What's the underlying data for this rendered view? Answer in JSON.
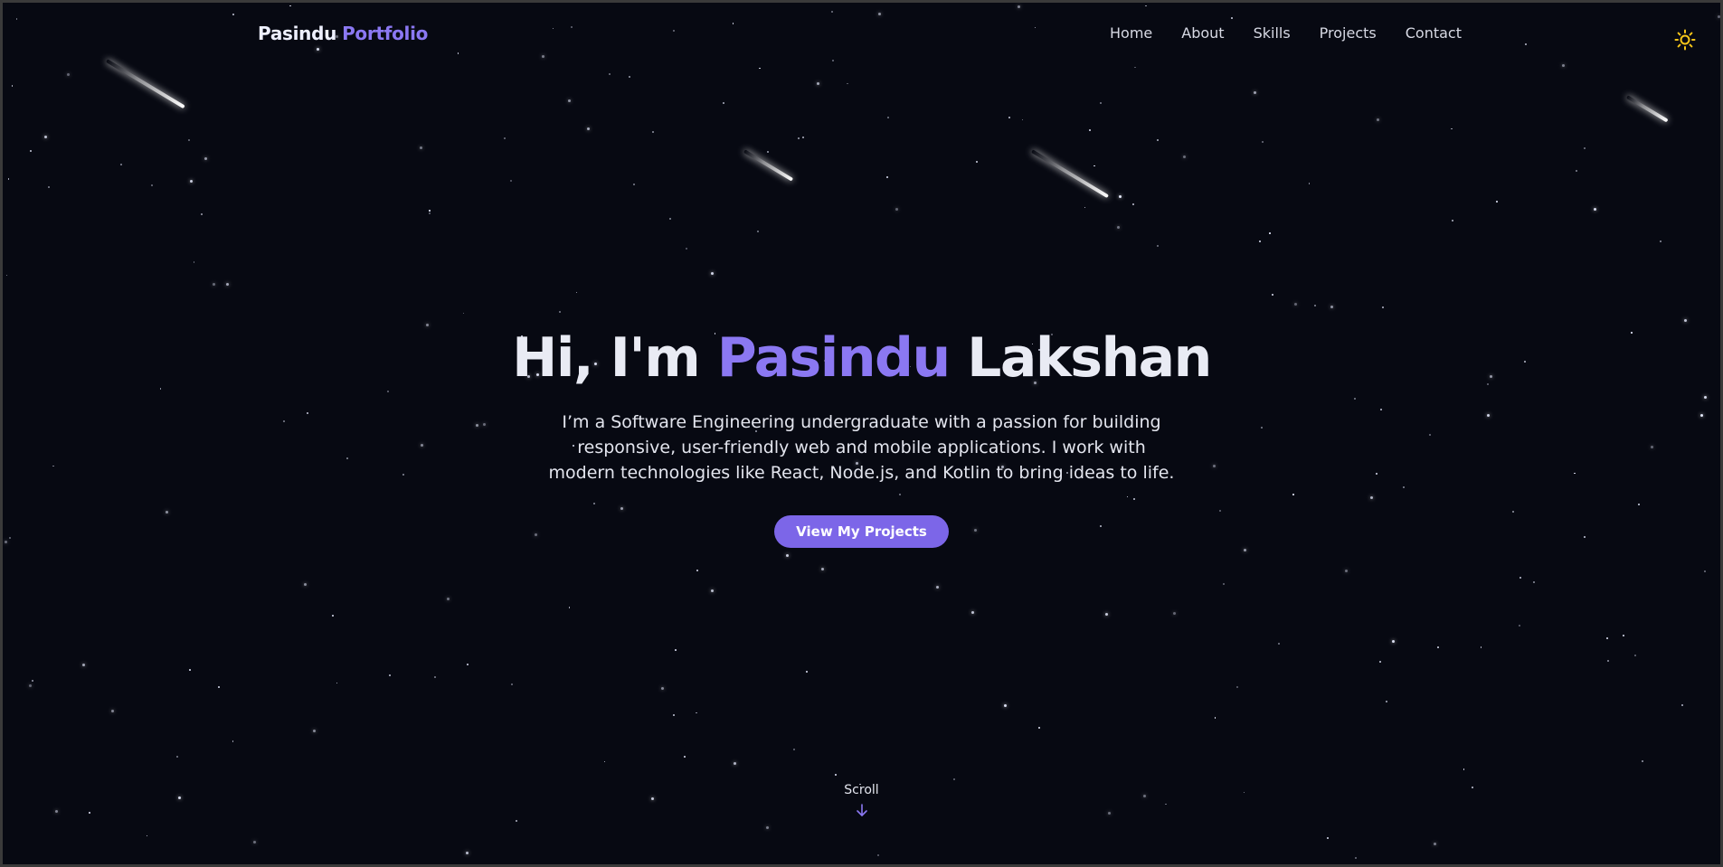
{
  "header": {
    "logo_first": "Pasindu",
    "logo_second": "Portfolio",
    "nav": [
      "Home",
      "About",
      "Skills",
      "Projects",
      "Contact"
    ],
    "theme_toggle_icon": "sun-icon"
  },
  "hero": {
    "greeting": "Hi, I'm",
    "first_name": "Pasindu",
    "last_name": "Lakshan",
    "description": "I’m a Software Engineering undergraduate with a passion for building responsive, user-friendly web and mobile applications. I work with modern technologies like React, Node.js, and Kotlin to bring ideas to life.",
    "cta_label": "View My Projects"
  },
  "scroll": {
    "label": "Scroll",
    "icon": "arrow-down-icon"
  },
  "colors": {
    "background": "#070912",
    "accent": "#8b78f2",
    "button": "#7c66e8",
    "sun": "#f5c518"
  }
}
